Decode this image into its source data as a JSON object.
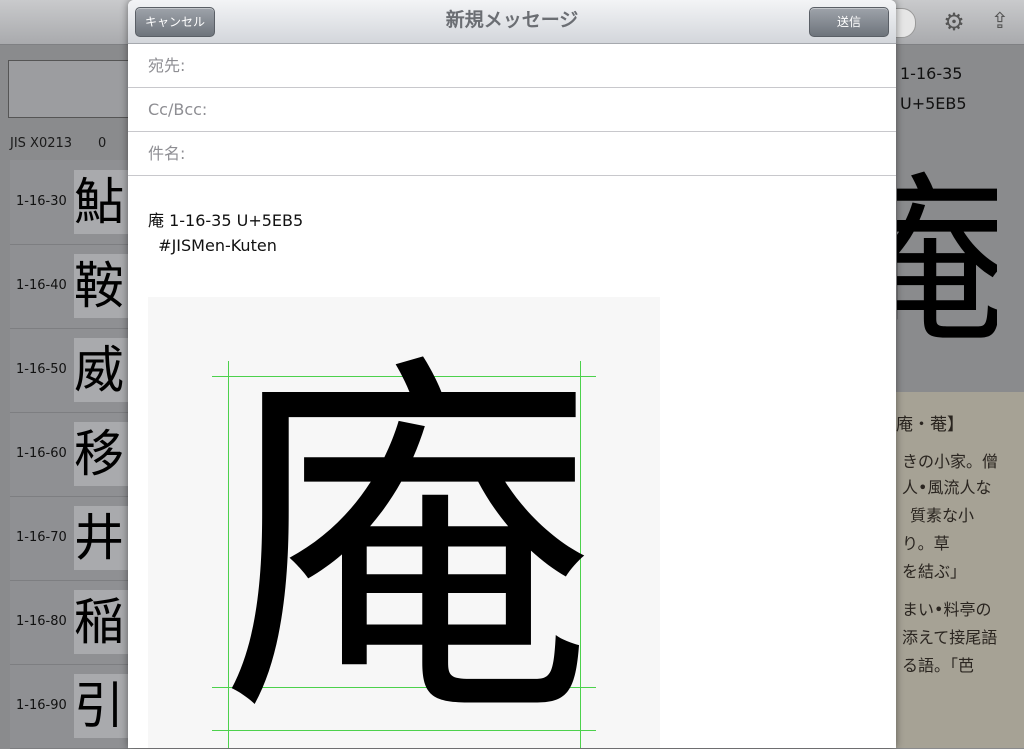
{
  "background": {
    "jis_label": "JIS X0213",
    "count": "0",
    "rows": [
      {
        "code": "1-16-30",
        "char": "鮎"
      },
      {
        "code": "1-16-40",
        "char": "鞍"
      },
      {
        "code": "1-16-50",
        "char": "威"
      },
      {
        "code": "1-16-60",
        "char": "移"
      },
      {
        "code": "1-16-70",
        "char": "井"
      },
      {
        "code": "1-16-80",
        "char": "稲"
      },
      {
        "code": "1-16-90",
        "char": "引"
      }
    ],
    "right_code": "1-16-35",
    "right_unicode": "U+5EB5",
    "right_glyph": "庵",
    "dict_head": "庵・菴】",
    "dict_lines": [
      "きの小家。僧",
      "人•風流人な",
      "質素な小",
      "り。草",
      "を結ぶ」",
      "まい•料亭の",
      "添えて接尾語",
      "る語。「芭"
    ],
    "icons": {
      "gear": "gear-icon",
      "share": "share-icon"
    }
  },
  "compose": {
    "title": "新規メッセージ",
    "cancel_label": "キャンセル",
    "send_label": "送信",
    "to_label": "宛先:",
    "cc_label": "Cc/Bcc:",
    "subject_label": "件名:",
    "body_line1": "庵 1-16-35 U+5EB5",
    "body_line2": "  #JISMen-Kuten",
    "attachment_glyph": "庵"
  },
  "colors": {
    "guide_line": "#4cd14c",
    "nav_button": "#7c828a"
  }
}
